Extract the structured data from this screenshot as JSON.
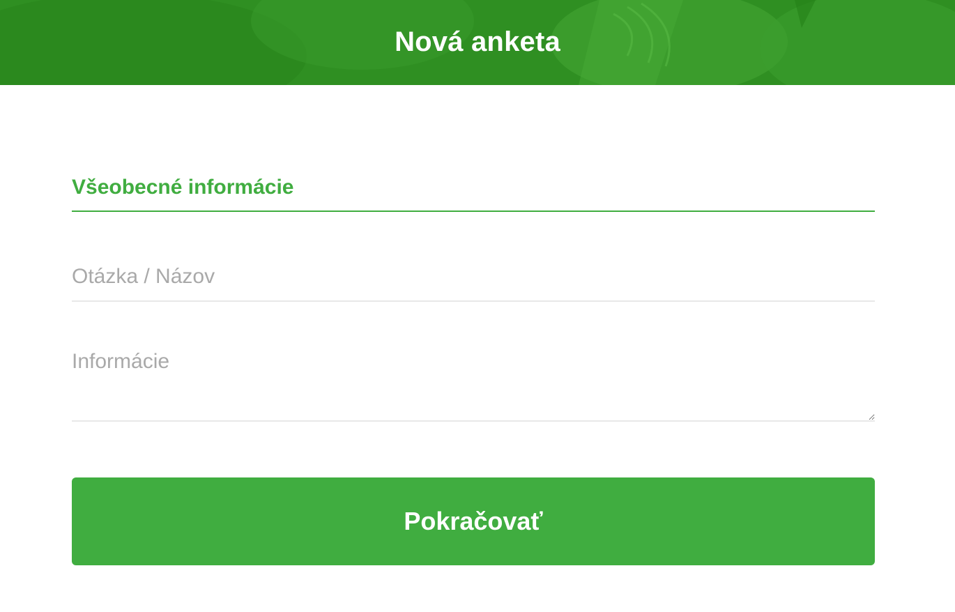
{
  "header": {
    "title": "Nová anketa",
    "background_color": "#2f8f22"
  },
  "form": {
    "section_title": "Všeobecné informácie",
    "question_field": {
      "placeholder": "Otázka / Názov",
      "value": ""
    },
    "info_field": {
      "placeholder": "Informácie",
      "value": ""
    },
    "continue_label": "Pokračovať"
  },
  "colors": {
    "accent": "#40ad40",
    "divider": "#e8e8e8",
    "placeholder": "#a9a9a9"
  }
}
